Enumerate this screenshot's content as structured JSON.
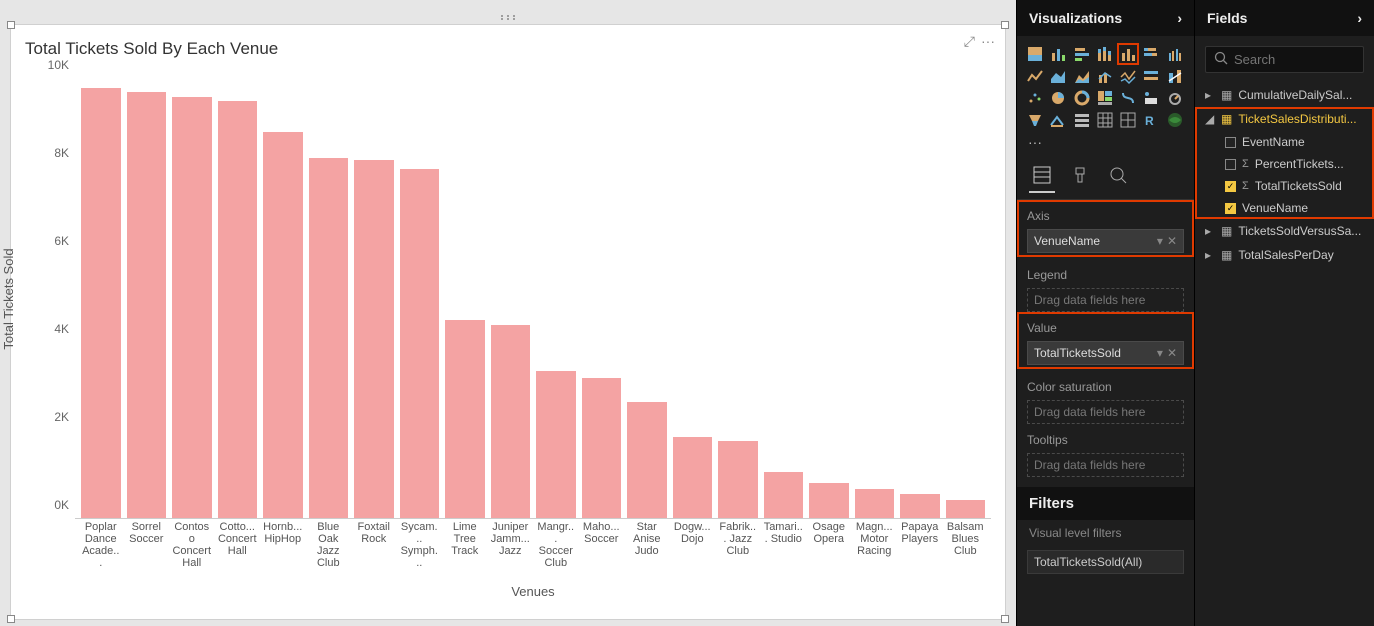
{
  "chart_data": {
    "type": "bar",
    "title": "Total Tickets Sold By Each Venue",
    "xlabel": "Venues",
    "ylabel": "Total Tickets Sold",
    "ylim": [
      0,
      10000
    ],
    "y_ticks": [
      "0K",
      "2K",
      "4K",
      "6K",
      "8K",
      "10K"
    ],
    "categories": [
      "Poplar Dance Acade...",
      "Sorrel Soccer",
      "Contoso Concert Hall",
      "Cotto... Concert Hall",
      "Hornb... HipHop",
      "Blue Oak Jazz Club",
      "Foxtail Rock",
      "Sycam... Symph...",
      "Lime Tree Track",
      "Juniper Jamm... Jazz",
      "Mangr... Soccer Club",
      "Maho... Soccer",
      "Star Anise Judo",
      "Dogw... Dojo",
      "Fabrik... Jazz Club",
      "Tamari... Studio",
      "Osage Opera",
      "Magn... Motor Racing",
      "Papaya Players",
      "Balsam Blues Club"
    ],
    "values": [
      9800,
      9700,
      9600,
      9500,
      8800,
      8200,
      8150,
      7950,
      4500,
      4400,
      3350,
      3200,
      2650,
      1850,
      1750,
      1050,
      800,
      650,
      550,
      400
    ]
  },
  "visualizations_panel": {
    "title": "Visualizations",
    "selected_viz_index": 4,
    "axis": {
      "label": "Axis",
      "value": "VenueName"
    },
    "legend": {
      "label": "Legend",
      "placeholder": "Drag data fields here"
    },
    "value": {
      "label": "Value",
      "value": "TotalTicketsSold"
    },
    "color_sat": {
      "label": "Color saturation",
      "placeholder": "Drag data fields here"
    },
    "tooltips": {
      "label": "Tooltips",
      "placeholder": "Drag data fields here"
    },
    "filters": {
      "title": "Filters",
      "visual_label": "Visual level filters",
      "item": "TotalTicketsSold(All)"
    }
  },
  "fields_panel": {
    "title": "Fields",
    "search_placeholder": "Search",
    "tables": [
      {
        "name": "CumulativeDailySal...",
        "expanded": false
      },
      {
        "name": "TicketSalesDistributi...",
        "expanded": true,
        "highlighted": true,
        "fields": [
          {
            "name": "EventName",
            "checked": false,
            "sigma": false
          },
          {
            "name": "PercentTickets...",
            "checked": false,
            "sigma": true
          },
          {
            "name": "TotalTicketsSold",
            "checked": true,
            "sigma": true
          },
          {
            "name": "VenueName",
            "checked": true,
            "sigma": false
          }
        ]
      },
      {
        "name": "TicketsSoldVersusSa...",
        "expanded": false
      },
      {
        "name": "TotalSalesPerDay",
        "expanded": false
      }
    ]
  },
  "icons": {
    "chevron_right": "›",
    "chevron_down": "▾",
    "expand_arrow": "▸",
    "more": "···",
    "search": "🔍",
    "remove": "✕",
    "focus": "⤢"
  }
}
